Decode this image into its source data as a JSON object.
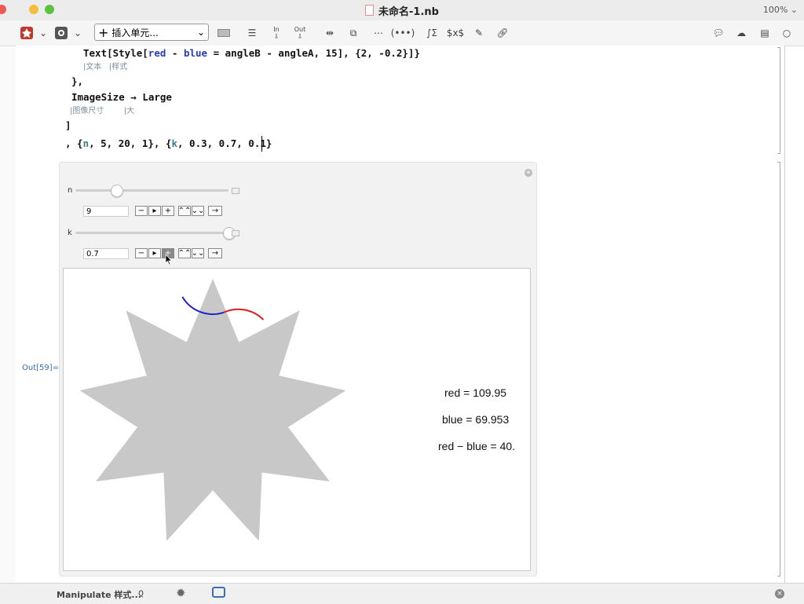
{
  "window": {
    "title": "未命名-1.nb",
    "zoom": "100%"
  },
  "toolbar": {
    "insert_cell_label": "插入单元...",
    "in_label": "In",
    "out_label": "Out"
  },
  "code": {
    "line1_prefix": "Text[Style[",
    "line1_red": "red",
    "line1_dash": " - ",
    "line1_blue": "blue",
    "line1_rest": " = angleB - angleA, 15], {2, -0.2}]}",
    "line1_hint": "|文本   |样式",
    "line2": "},",
    "line3_a": "ImageSize",
    "line3_arrow": " → ",
    "line3_b": "Large",
    "line3_hint": "|图像尺寸        |大",
    "line4": "]",
    "line5_a": ", {",
    "line5_n": "n",
    "line5_b": ", 5, 20, 1}, {",
    "line5_k": "k",
    "line5_c": ", 0.3, 0.7, 0.1}"
  },
  "output_label": "Out[59]=",
  "manipulate": {
    "n": {
      "label": "n",
      "value": "9",
      "min": 5,
      "max": 20,
      "current": 9
    },
    "k": {
      "label": "k",
      "value": "0.7",
      "min": 0.3,
      "max": 0.7,
      "current": 0.7
    },
    "anim_buttons": [
      "−",
      "▸",
      "+",
      "⌃⌃",
      "⌄⌄",
      "→"
    ]
  },
  "graphic": {
    "red_text": "red = 109.95",
    "blue_text": "blue = 69.953",
    "diff_text": "red − blue = 40.",
    "star_color": "#c8c8c8",
    "red_arc_color": "#d62020",
    "blue_arc_color": "#2020d0"
  },
  "bottom": {
    "style_label": "Manipulate 样式..."
  },
  "colors": {
    "toolbar_icon_red": "#c0392b"
  }
}
